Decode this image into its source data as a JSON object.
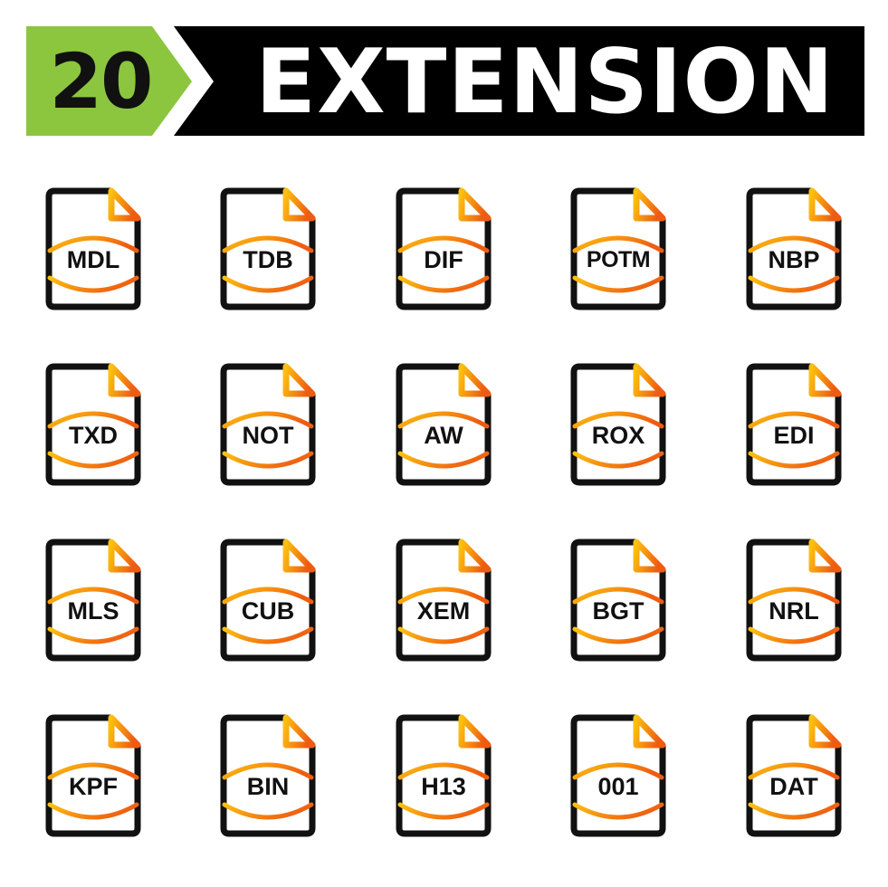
{
  "banner": {
    "count": "20",
    "title": "EXTENSION",
    "colors": {
      "count_bg": "#8cc63f",
      "title_bg": "#000000",
      "title_text": "#ffffff",
      "count_text": "#111111"
    }
  },
  "icon_style": {
    "outline_color": "#111111",
    "gradient_start": "#fcc10f",
    "gradient_end": "#ee5c12"
  },
  "icons": [
    {
      "label": "MDL"
    },
    {
      "label": "TDB"
    },
    {
      "label": "DIF"
    },
    {
      "label": "POTM"
    },
    {
      "label": "NBP"
    },
    {
      "label": "TXD"
    },
    {
      "label": "NOT"
    },
    {
      "label": "AW"
    },
    {
      "label": "ROX"
    },
    {
      "label": "EDI"
    },
    {
      "label": "MLS"
    },
    {
      "label": "CUB"
    },
    {
      "label": "XEM"
    },
    {
      "label": "BGT"
    },
    {
      "label": "NRL"
    },
    {
      "label": "KPF"
    },
    {
      "label": "BIN"
    },
    {
      "label": "H13"
    },
    {
      "label": "001"
    },
    {
      "label": "DAT"
    }
  ]
}
